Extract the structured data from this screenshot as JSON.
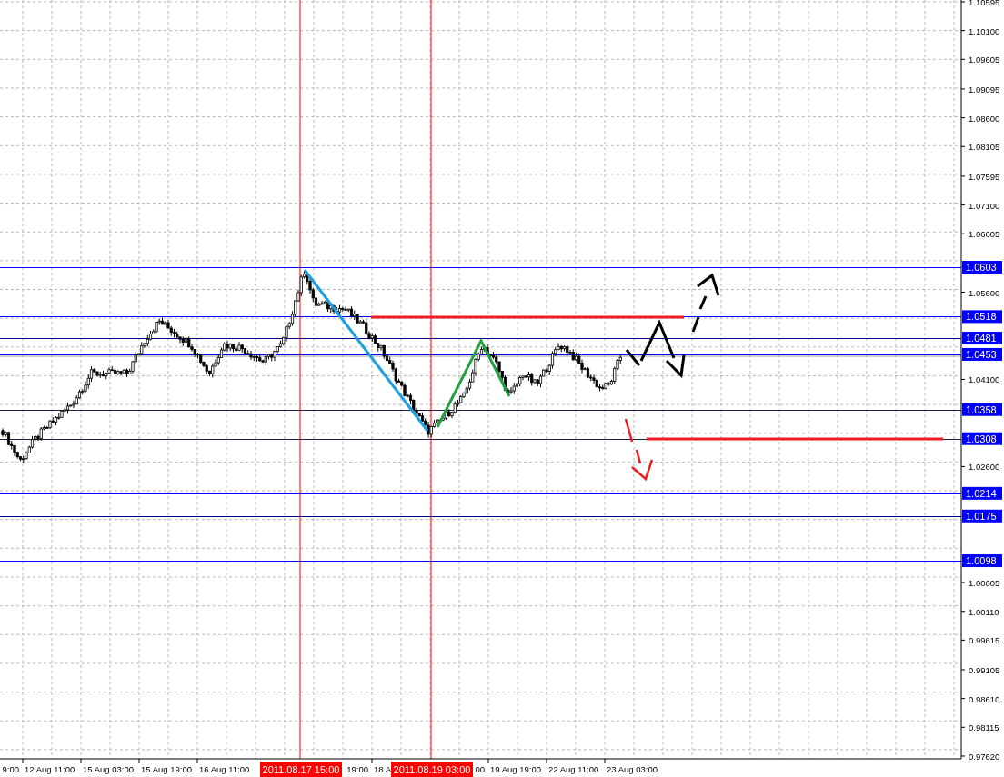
{
  "chart": {
    "price_axis": {
      "ticks": [
        "1.10595",
        "1.10100",
        "1.09605",
        "1.09095",
        "1.08600",
        "1.08105",
        "1.07595",
        "1.07100",
        "1.06605",
        "1.05600",
        "1.04100",
        "1.02600",
        "1.00605",
        "1.00110",
        "0.99615",
        "0.99105",
        "0.98610",
        "0.98115",
        "0.97620"
      ]
    },
    "time_axis": {
      "labels": [
        {
          "text": "9:00",
          "kind": "tail"
        },
        {
          "text": "12 Aug 11:00",
          "kind": "head"
        },
        {
          "text": "15 Aug 03:00",
          "kind": "head"
        },
        {
          "text": "15 Aug 19:00",
          "kind": "head"
        },
        {
          "text": "16 Aug 11:00",
          "kind": "head"
        },
        {
          "text": "19:00",
          "kind": "tail"
        },
        {
          "text": "18 A",
          "kind": "head"
        },
        {
          "text": "00",
          "kind": "tail"
        },
        {
          "text": "19 Aug 19:00",
          "kind": "head"
        },
        {
          "text": "22 Aug 11:00",
          "kind": "head"
        },
        {
          "text": "23 Aug 03:00",
          "kind": "head"
        }
      ]
    },
    "price_levels": [
      {
        "label": "1.0603",
        "color": "#0000ff"
      },
      {
        "label": "1.0518",
        "color": "#0000ff"
      },
      {
        "label": "1.0481",
        "color": "#00008b"
      },
      {
        "label": "1.0453",
        "color": "#0000ff"
      },
      {
        "label": "1.0358",
        "color": "#202040"
      },
      {
        "label": "1.0308",
        "color": "#202040"
      },
      {
        "label": "1.0214",
        "color": "#0000ff"
      },
      {
        "label": "1.0175",
        "color": "#00008b"
      },
      {
        "label": "1.0098",
        "color": "#0000ff"
      }
    ],
    "time_markers": [
      {
        "label": "2011.08.17 15:00"
      },
      {
        "label": "2011.08.19 03:00"
      }
    ]
  }
}
